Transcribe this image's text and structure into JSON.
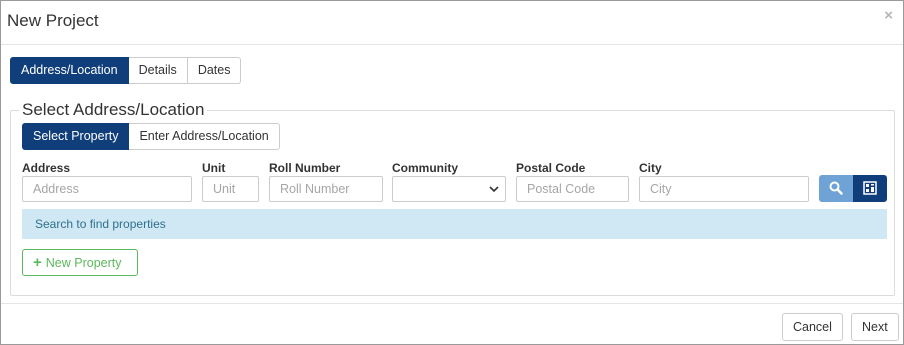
{
  "modal": {
    "title": "New Project",
    "close_glyph": "×"
  },
  "tabs": [
    {
      "label": "Address/Location",
      "active": true
    },
    {
      "label": "Details",
      "active": false
    },
    {
      "label": "Dates",
      "active": false
    }
  ],
  "section": {
    "legend": "Select Address/Location"
  },
  "subtabs": [
    {
      "label": "Select Property",
      "active": true
    },
    {
      "label": "Enter Address/Location",
      "active": false
    }
  ],
  "fields": {
    "address": {
      "label": "Address",
      "placeholder": "Address",
      "value": ""
    },
    "unit": {
      "label": "Unit",
      "placeholder": "Unit",
      "value": ""
    },
    "roll_number": {
      "label": "Roll Number",
      "placeholder": "Roll Number",
      "value": ""
    },
    "community": {
      "label": "Community",
      "value": ""
    },
    "postal_code": {
      "label": "Postal Code",
      "placeholder": "Postal Code",
      "value": ""
    },
    "city": {
      "label": "City",
      "placeholder": "City",
      "value": ""
    }
  },
  "icons": {
    "search": "search-icon",
    "map": "map-icon",
    "dropdown": "chevron-down-icon"
  },
  "info_message": "Search to find properties",
  "new_property_button": {
    "icon": "+",
    "label": "New Property"
  },
  "footer": {
    "cancel_label": "Cancel",
    "next_label": "Next"
  },
  "colors": {
    "primary": "#0f3e7a",
    "search_button": "#6fa3d6",
    "info_background": "#cfe8f3",
    "success": "#5cb85c"
  }
}
